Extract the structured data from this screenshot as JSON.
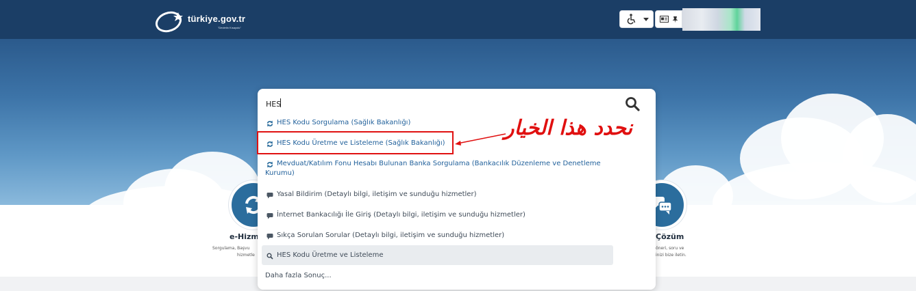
{
  "header": {
    "logo_text": "türkiye.gov.tr",
    "logo_sub": "\"Devletin Kısayolu\""
  },
  "search": {
    "value": "HES",
    "results": [
      {
        "icon": "refresh-icon",
        "text": "HES Kodu Sorgulama (Sağlık Bakanlığı)"
      },
      {
        "icon": "refresh-icon",
        "text": "HES Kodu Üretme ve Listeleme (Sağlık Bakanlığı)"
      },
      {
        "icon": "refresh-icon",
        "text": "Mevduat/Katılım Fonu Hesabı Bulunan Banka Sorgulama (Bankacılık Düzenleme ve Denetleme Kurumu)"
      },
      {
        "icon": "chat-icon",
        "text": "Yasal Bildirim (Detaylı bilgi, iletişim ve sunduğu hizmetler)"
      },
      {
        "icon": "chat-icon",
        "text": "İnternet Bankacılığı İle Giriş (Detaylı bilgi, iletişim ve sunduğu hizmetler)"
      },
      {
        "icon": "chat-icon",
        "text": "Sıkça Sorulan Sorular (Detaylı bilgi, iletişim ve sunduğu hizmetler)"
      },
      {
        "icon": "search-icon",
        "text": "HES Kodu Üretme ve Listeleme"
      }
    ],
    "more": "Daha fazla Sonuç..."
  },
  "features": {
    "left_title": "e-Hizme",
    "left_sub_1": "Sorgulama, Başvu",
    "left_sub_2": "hizmetle",
    "right_title": "Çözüm",
    "right_sub_1": "öneri, soru ve",
    "right_sub_2": "inizi bize iletin."
  },
  "annotation": {
    "text": "نحدد هذا الخيار",
    "color": "#e01010"
  },
  "colors": {
    "header": "#1b3e66",
    "link": "#1f5f9a",
    "accent": "#2b6d9d"
  }
}
